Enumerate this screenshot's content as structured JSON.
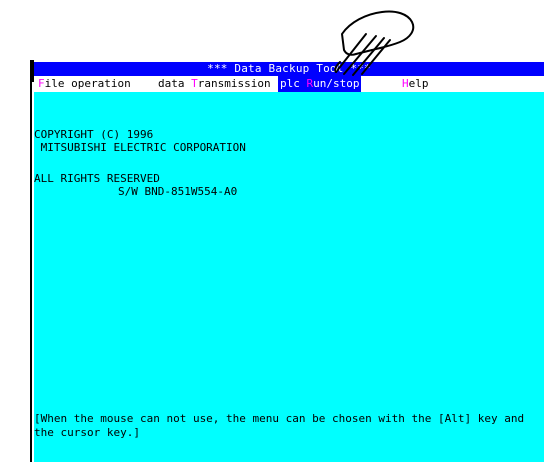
{
  "window": {
    "title": "***  Data Backup Tool  ***"
  },
  "menu": {
    "items": [
      {
        "hot": "F",
        "rest": "ile operation"
      },
      {
        "pre": "data ",
        "hot": "T",
        "rest": "ransmission"
      },
      {
        "pre": "plc ",
        "hot": "R",
        "rest": "un/stop"
      },
      {
        "hot": "H",
        "rest": "elp"
      }
    ]
  },
  "content": {
    "copyright_line1": "COPYRIGHT (C) 1996",
    "copyright_line2": " MITSUBISHI ELECTRIC CORPORATION",
    "rights": "ALL RIGHTS RESERVED",
    "software": "S/W BND-851W554-A0",
    "hint_line1": "[When the mouse can not use, the menu can be chosen with the [Alt] key and",
    "hint_line2": "the cursor key.]"
  },
  "colors": {
    "title_bg": "#0000ff",
    "content_bg": "#00ffff",
    "hotkey": "#ff00ff"
  },
  "pointer": {
    "icon": "hand-pointer-icon"
  }
}
